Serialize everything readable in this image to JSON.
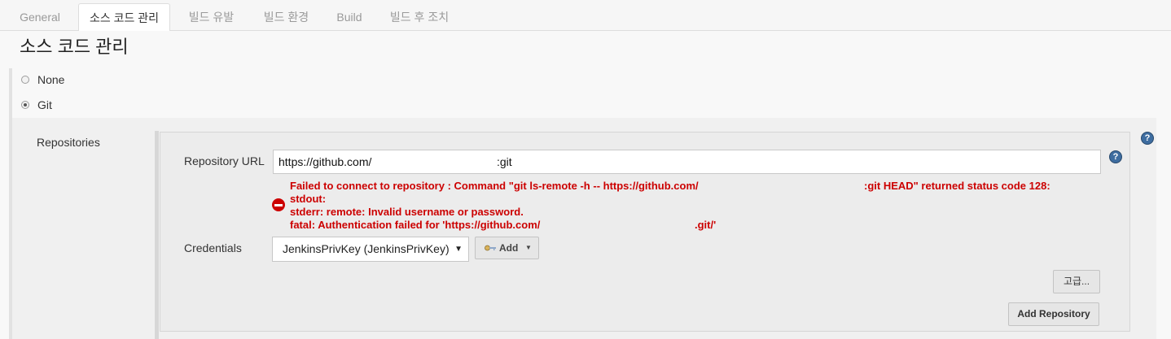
{
  "tabs": [
    {
      "label": "General",
      "active": false
    },
    {
      "label": "소스 코드 관리",
      "active": true
    },
    {
      "label": "빌드 유발",
      "active": false
    },
    {
      "label": "빌드 환경",
      "active": false
    },
    {
      "label": "Build",
      "active": false
    },
    {
      "label": "빌드 후 조치",
      "active": false
    }
  ],
  "section": {
    "title": "소스 코드 관리"
  },
  "scm_options": [
    {
      "label": "None",
      "checked": false
    },
    {
      "label": "Git",
      "checked": true
    }
  ],
  "repositories": {
    "label": "Repositories",
    "url_label": "Repository URL",
    "url_value": "https://github.com/",
    "url_suffix": ":git",
    "help": "?",
    "error": {
      "line1_a": "Failed to connect to repository : Command \"git ls-remote -h -- https://github.com/",
      "line1_b": ":git HEAD\" returned status code 128:",
      "line2": "stdout:",
      "line3": "stderr: remote: Invalid username or password.",
      "line4_a": "fatal: Authentication failed for 'https://github.com/",
      "line4_b": ".git/'"
    },
    "credentials_label": "Credentials",
    "credentials_value": "JenkinsPrivKey (JenkinsPrivKey)",
    "add_label": "Add",
    "advanced_label": "고급...",
    "add_repository_label": "Add Repository"
  },
  "colors": {
    "error": "#cc0000",
    "help": "#3e6da0"
  }
}
